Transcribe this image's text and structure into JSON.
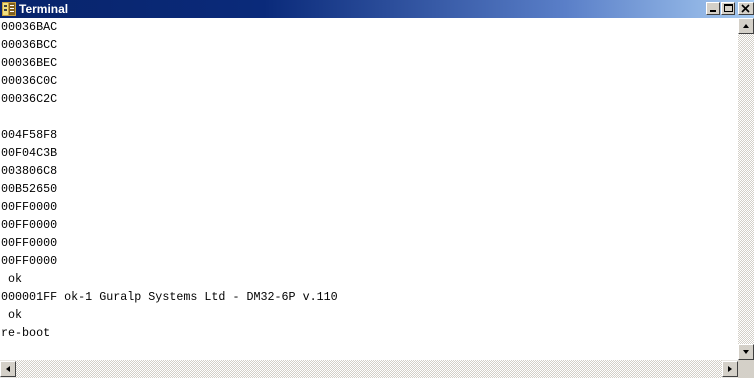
{
  "window": {
    "title": "Terminal",
    "icon": "terminal-app-icon",
    "controls": [
      "minimize-icon",
      "maximize-icon",
      "close-icon"
    ]
  },
  "terminal": {
    "lines": [
      "00036BAC",
      "00036BCC",
      "00036BEC",
      "00036C0C",
      "00036C2C",
      "",
      "004F58F8",
      "00F04C3B",
      "003806C8",
      "00B52650",
      "00FF0000",
      "00FF0000",
      "00FF0000",
      "00FF0000",
      " ok",
      "000001FF ok-1 Guralp Systems Ltd - DM32-6P v.110",
      " ok",
      "re-boot"
    ]
  },
  "colors": {
    "titlebar_start": "#08246b",
    "titlebar_end": "#a6caf0",
    "chrome": "#d4d0c8",
    "terminal_bg": "#ffffff",
    "terminal_fg": "#000000"
  }
}
